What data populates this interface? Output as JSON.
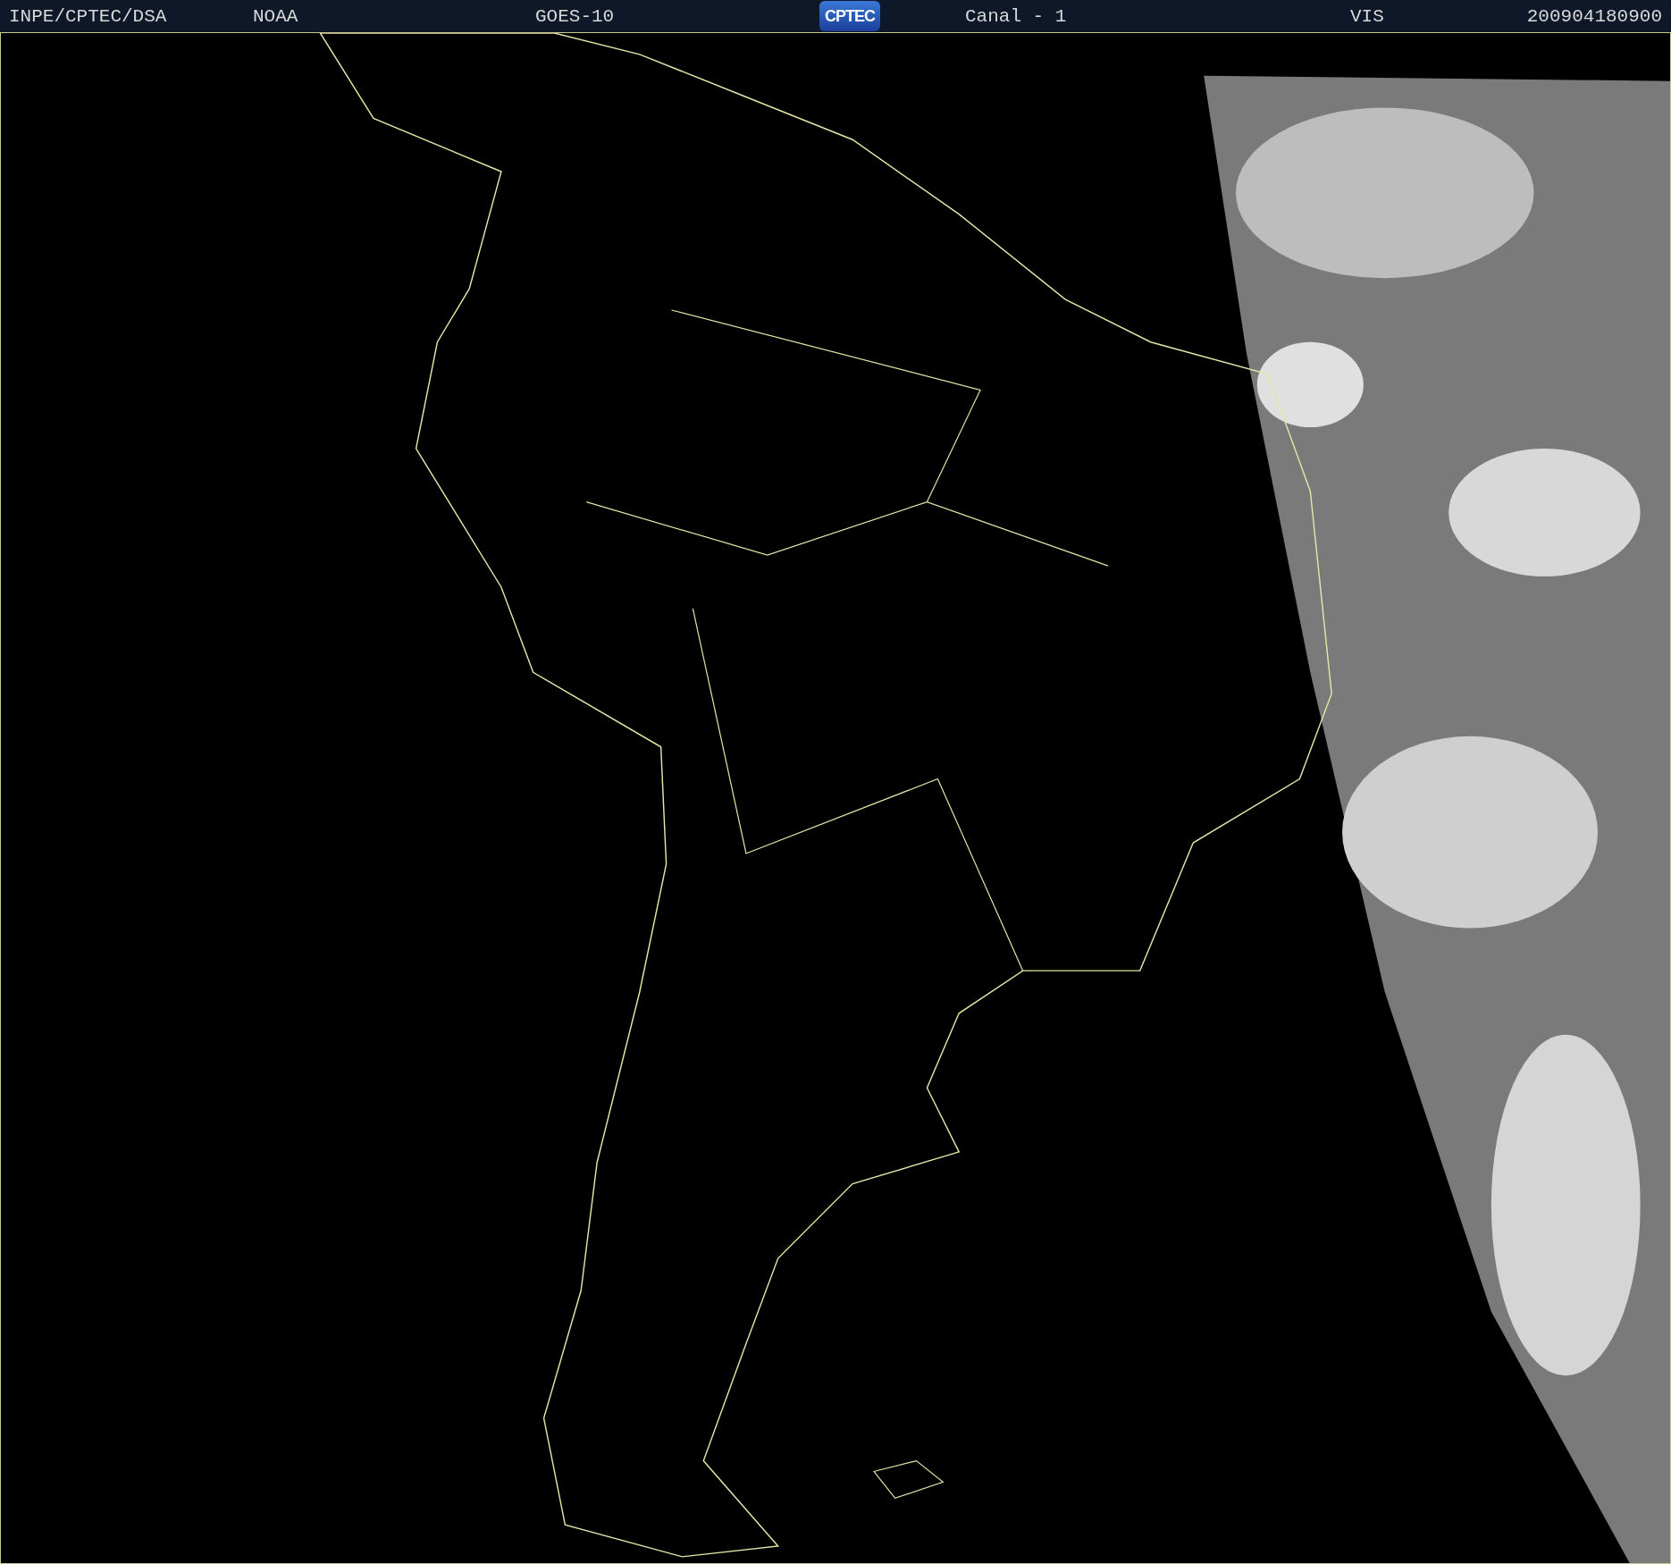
{
  "header": {
    "items": [
      {
        "kind": "text",
        "text": "INPE/CPTEC/DSA"
      },
      {
        "kind": "text",
        "text": "NOAA"
      },
      {
        "kind": "text",
        "text": "GOES-10"
      },
      {
        "kind": "logo",
        "text": "CPTEC"
      },
      {
        "kind": "text",
        "text": "Canal - 1"
      },
      {
        "kind": "text",
        "text": "VIS"
      },
      {
        "kind": "text",
        "text": "200904180900"
      }
    ]
  }
}
